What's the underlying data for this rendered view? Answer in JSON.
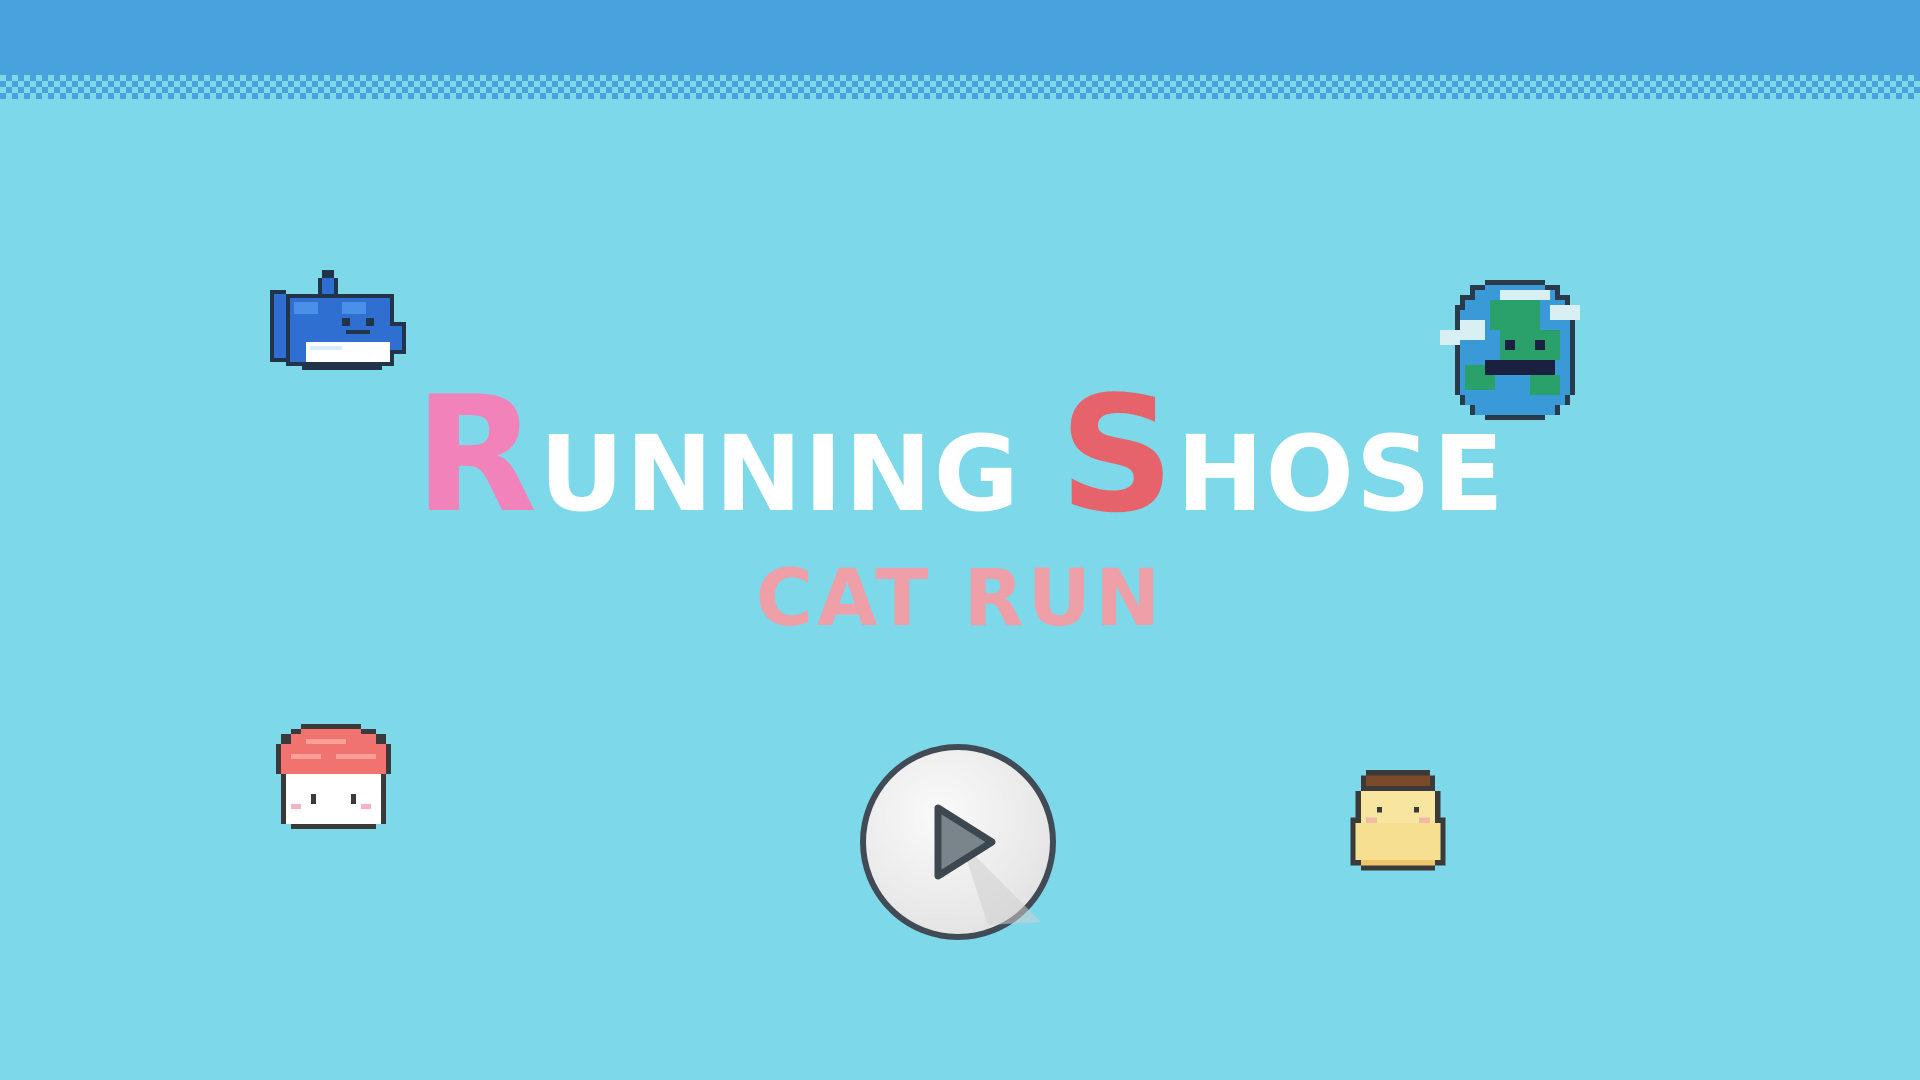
{
  "game": {
    "title_first_initial": "R",
    "title_first_rest": "UNNING ",
    "title_second_initial": "S",
    "title_second_rest": "HOSE",
    "subtitle": "CAT RUN"
  },
  "controls": {
    "play_icon": "play-icon"
  },
  "characters": [
    {
      "name": "shark-cat",
      "icon": "shark-icon"
    },
    {
      "name": "earth-cat",
      "icon": "earth-icon"
    },
    {
      "name": "sushi-cat",
      "icon": "sushi-icon"
    },
    {
      "name": "pudding-cat",
      "icon": "pudding-icon"
    }
  ],
  "colors": {
    "sky": "#7dd8ea",
    "top_bar": "#47a2de",
    "title_r": "#f283ba",
    "title_s": "#e6636c",
    "title_rest": "#ffffff",
    "subtitle": "#ee9fa8",
    "button_ring": "#414b55"
  }
}
